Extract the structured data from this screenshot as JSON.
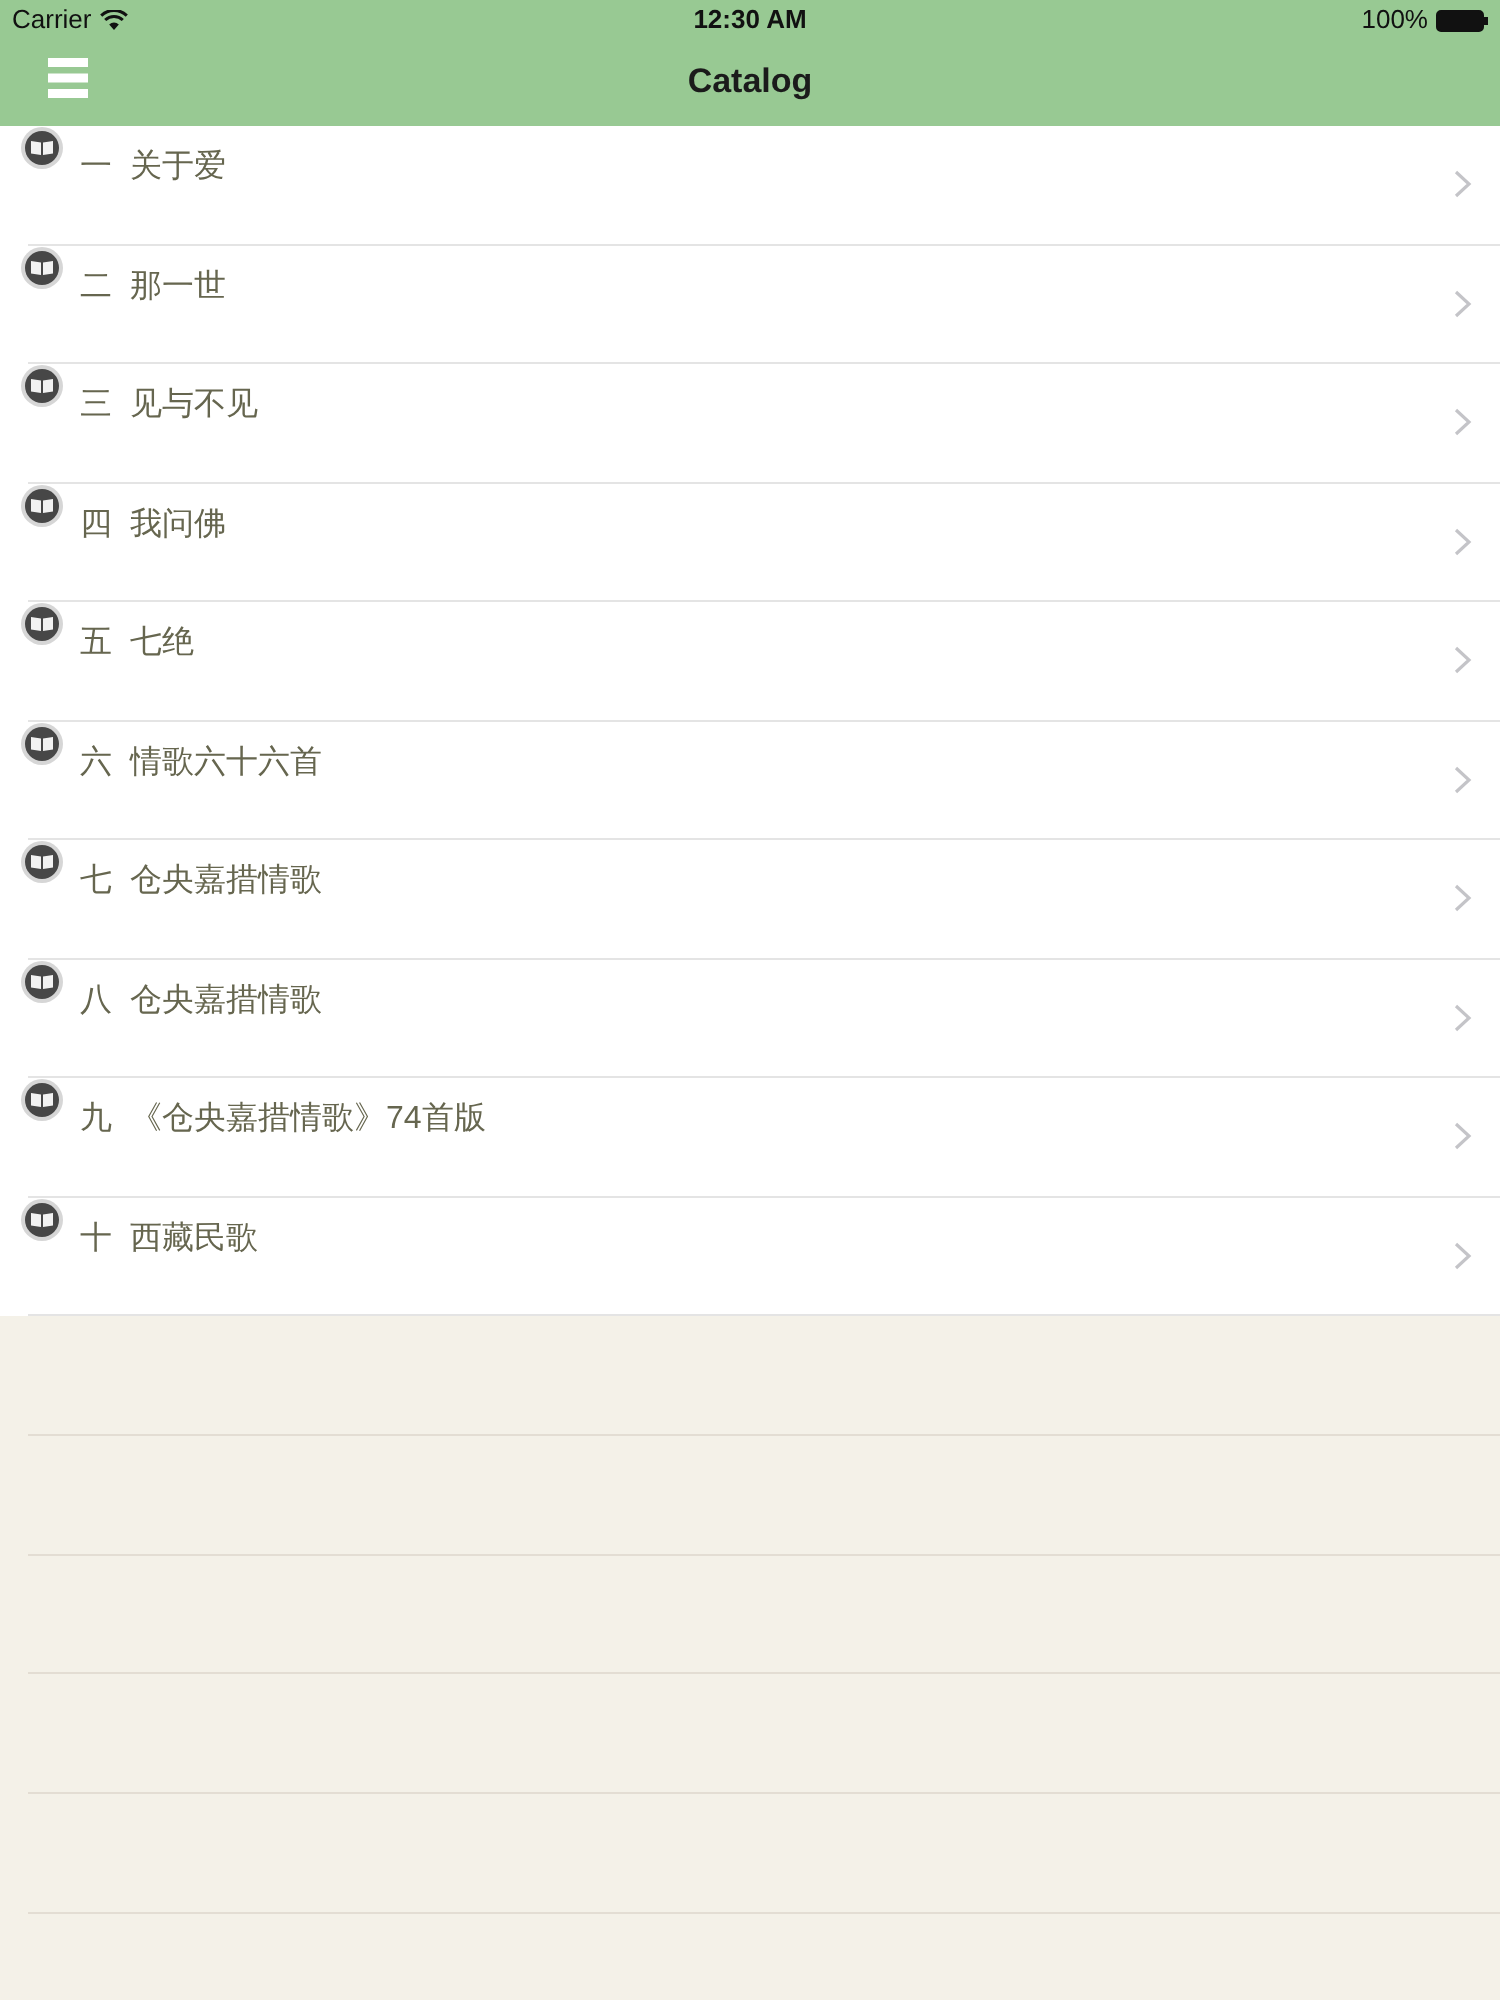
{
  "status_bar": {
    "carrier": "Carrier",
    "time": "12:30 AM",
    "battery": "100%"
  },
  "nav_bar": {
    "title": "Catalog"
  },
  "chapters": [
    {
      "number": "一",
      "title": "关于爱"
    },
    {
      "number": "二",
      "title": "那一世"
    },
    {
      "number": "三",
      "title": "见与不见"
    },
    {
      "number": "四",
      "title": "我问佛"
    },
    {
      "number": "五",
      "title": "七绝"
    },
    {
      "number": "六",
      "title": "情歌六十六首"
    },
    {
      "number": "七",
      "title": "仓央嘉措情歌"
    },
    {
      "number": "八",
      "title": "仓央嘉措情歌"
    },
    {
      "number": "九",
      "title": "《仓央嘉措情歌》74首版"
    },
    {
      "number": "十",
      "title": "西藏民歌"
    }
  ]
}
